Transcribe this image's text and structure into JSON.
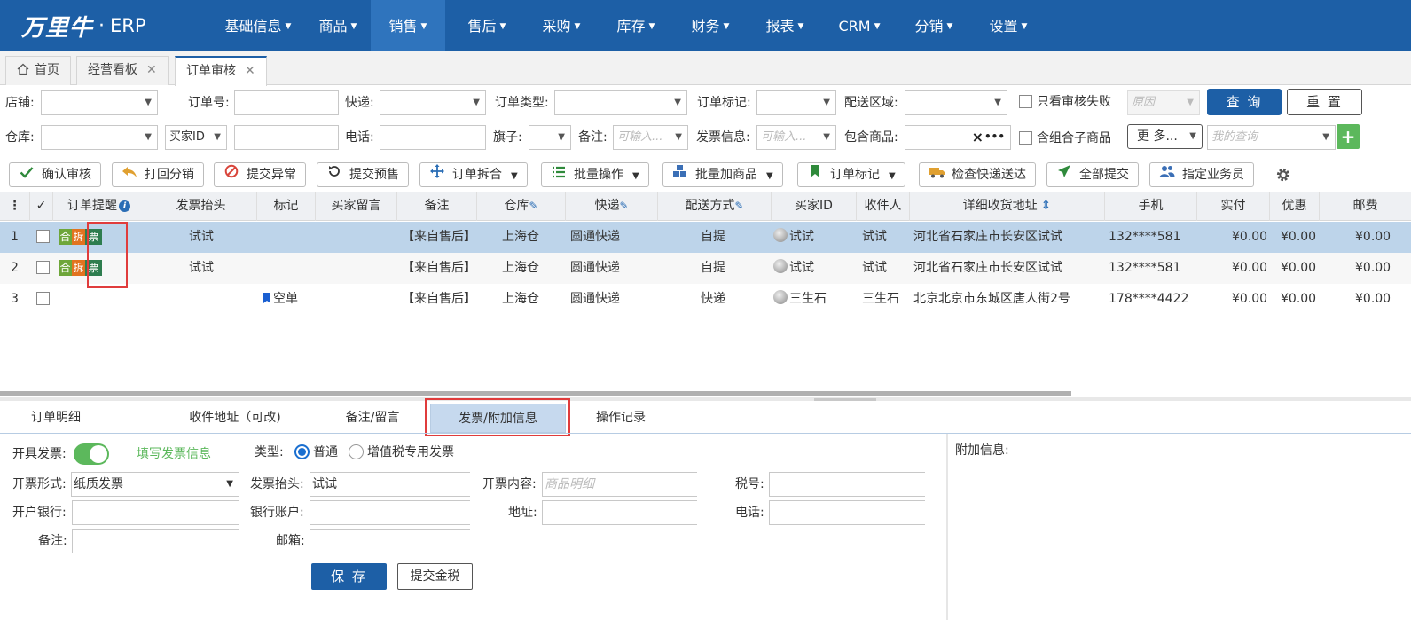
{
  "nav": {
    "logo_brand": "万里牛",
    "logo_dot": "·",
    "logo_product": "ERP",
    "items": [
      {
        "label": "基础信息"
      },
      {
        "label": "商品"
      },
      {
        "label": "销售"
      },
      {
        "label": "售后"
      },
      {
        "label": "采购"
      },
      {
        "label": "库存"
      },
      {
        "label": "财务"
      },
      {
        "label": "报表"
      },
      {
        "label": "CRM"
      },
      {
        "label": "分销"
      },
      {
        "label": "设置"
      }
    ],
    "active": "销售"
  },
  "tabs": [
    {
      "label": "首页"
    },
    {
      "label": "经营看板"
    },
    {
      "label": "订单审核"
    }
  ],
  "filters": {
    "shop_label": "店铺:",
    "order_no_label": "订单号:",
    "express_label": "快递:",
    "order_type_label": "订单类型:",
    "order_mark_label": "订单标记:",
    "region_label": "配送区域:",
    "only_failed_label": "只看审核失败",
    "reason_placeholder": "原因",
    "query_button": "查 询",
    "reset_button": "重 置",
    "warehouse_label": "仓库:",
    "buyer_id_select": "买家ID",
    "phone_label": "电话:",
    "flag_label": "旗子:",
    "remark_label": "备注:",
    "remark_placeholder": "可输入...",
    "invoice_info_label": "发票信息:",
    "invoice_info_placeholder": "可输入...",
    "contains_goods_label": "包含商品:",
    "contains_goods_clear": "×",
    "contains_goods_more": "•••",
    "combo_child_label": "含组合子商品",
    "more_label": "更 多...",
    "my_query_placeholder": "我的查询",
    "add_label": "+"
  },
  "toolbar": [
    {
      "label": "确认审核",
      "icon": "check-icon"
    },
    {
      "label": "打回分销",
      "icon": "reply-icon"
    },
    {
      "label": "提交异常",
      "icon": "ban-icon"
    },
    {
      "label": "提交预售",
      "icon": "refresh-icon"
    },
    {
      "label": "订单拆合",
      "icon": "move-icon"
    },
    {
      "label": "批量操作",
      "icon": "list-icon"
    },
    {
      "label": "批量加商品",
      "icon": "cubes-icon"
    },
    {
      "label": "订单标记",
      "icon": "bookmark-icon"
    },
    {
      "label": "检查快递送达",
      "icon": "truck-icon"
    },
    {
      "label": "全部提交",
      "icon": "send-icon"
    },
    {
      "label": "指定业务员",
      "icon": "users-icon"
    }
  ],
  "table": {
    "menu_glyph": "⋮",
    "check_glyph": "✓",
    "info_glyph": "i",
    "sort_glyph": "⇕",
    "edit_glyph": "✎",
    "headers": {
      "reminder": "订单提醒",
      "invoice_title": "发票抬头",
      "mark": "标记",
      "buyer_msg": "买家留言",
      "remark": "备注",
      "warehouse": "仓库",
      "express": "快递",
      "delivery": "配送方式",
      "buyer_id": "买家ID",
      "receiver": "收件人",
      "address": "详细收货地址",
      "phone": "手机",
      "paid": "实付",
      "discount": "优惠",
      "postage": "邮费"
    },
    "rows": [
      {
        "no": "1",
        "b1": "合",
        "b2": "拆",
        "b3": "票",
        "invoice_title": "试试",
        "mark": "",
        "remark": "【来自售后】",
        "warehouse": "上海仓",
        "express": "圆通快递",
        "delivery": "自提",
        "buyer_id": "试试",
        "receiver": "试试",
        "address": "河北省石家庄市长安区试试",
        "phone": "132****581",
        "paid": "¥0.00",
        "discount": "¥0.00",
        "postage": "¥0.00"
      },
      {
        "no": "2",
        "b1": "合",
        "b2": "拆",
        "b3": "票",
        "invoice_title": "试试",
        "mark": "",
        "remark": "【来自售后】",
        "warehouse": "上海仓",
        "express": "圆通快递",
        "delivery": "自提",
        "buyer_id": "试试",
        "receiver": "试试",
        "address": "河北省石家庄市长安区试试",
        "phone": "132****581",
        "paid": "¥0.00",
        "discount": "¥0.00",
        "postage": "¥0.00"
      },
      {
        "no": "3",
        "b1": "",
        "b2": "",
        "b3": "",
        "invoice_title": "",
        "mark": "空单",
        "remark": "【来自售后】",
        "warehouse": "上海仓",
        "express": "圆通快递",
        "delivery": "快递",
        "buyer_id": "三生石",
        "receiver": "三生石",
        "address": "北京北京市东城区唐人街2号",
        "phone": "178****4422",
        "paid": "¥0.00",
        "discount": "¥0.00",
        "postage": "¥0.00"
      }
    ]
  },
  "bottom_tabs": [
    {
      "label": "订单明细"
    },
    {
      "label": "收件地址（可改)"
    },
    {
      "label": "备注/留言"
    },
    {
      "label": "发票/附加信息"
    },
    {
      "label": "操作记录"
    }
  ],
  "invoice_form": {
    "issue_label": "开具发票:",
    "issue_on": true,
    "fill_link": "填写发票信息",
    "type_label": "类型:",
    "type_normal": "普通",
    "type_vat": "增值税专用发票",
    "form_label": "开票形式:",
    "form_value": "纸质发票",
    "title_label": "发票抬头:",
    "title_value": "试试",
    "content_label": "开票内容:",
    "content_placeholder": "商品明细",
    "tax_label": "税号:",
    "bank_label": "开户银行:",
    "account_label": "银行账户:",
    "address_label": "地址:",
    "tel_label": "电话:",
    "remark_label": "备注:",
    "email_label": "邮箱:",
    "save_button": "保 存",
    "submit_tax_button": "提交金税",
    "extra_label": "附加信息:"
  },
  "colors": {
    "nav_bg": "#1d5fa6",
    "nav_active": "#2f74bd",
    "badge_he": "#6ea63a",
    "badge_chai": "#e2731f",
    "badge_piao": "#2e7d4f",
    "row_selected": "#bdd4ea",
    "toggle_on": "#5cb85c",
    "highlight_box": "#e03c3c"
  }
}
